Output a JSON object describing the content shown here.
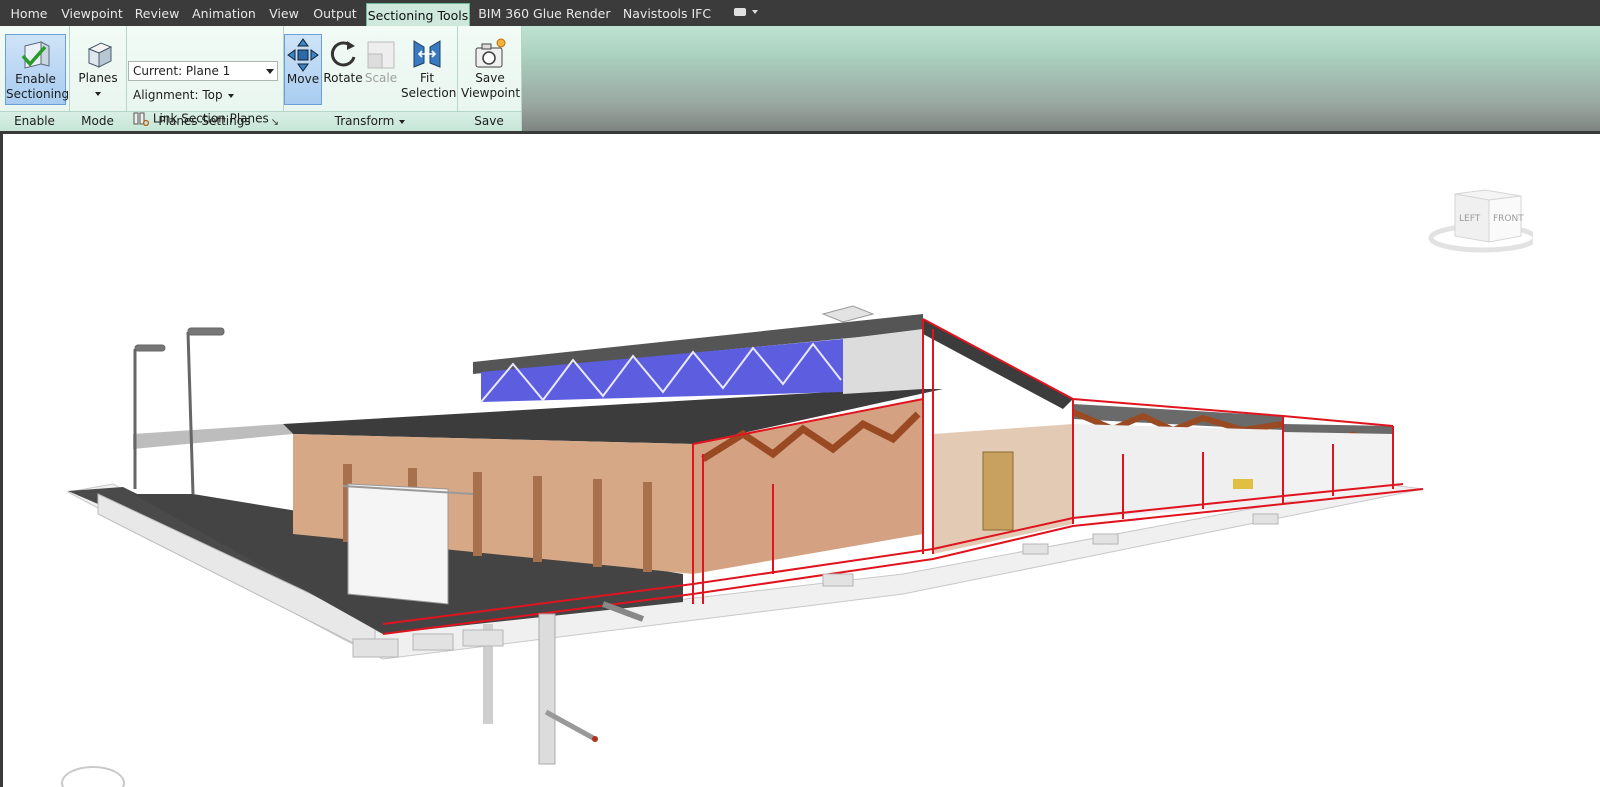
{
  "menubar": {
    "tabs": [
      {
        "label": "Home"
      },
      {
        "label": "Viewpoint"
      },
      {
        "label": "Review"
      },
      {
        "label": "Animation"
      },
      {
        "label": "View"
      },
      {
        "label": "Output"
      },
      {
        "label": "Sectioning Tools",
        "active": true
      },
      {
        "label": "BIM 360 Glue"
      },
      {
        "label": "Render"
      },
      {
        "label": "Navistools IFC"
      }
    ]
  },
  "ribbon": {
    "enable": {
      "button_label_1": "Enable",
      "button_label_2": "Sectioning",
      "panel_title": "Enable"
    },
    "mode": {
      "button_label": "Planes",
      "panel_title": "Mode"
    },
    "planes_settings": {
      "current_plane": "Current: Plane 1",
      "alignment_label": "Alignment: Top",
      "link_label": "Link Section Planes",
      "panel_title": "Planes Settings"
    },
    "transform": {
      "move_label": "Move",
      "rotate_label": "Rotate",
      "scale_label": "Scale",
      "fit_label_1": "Fit",
      "fit_label_2": "Selection",
      "panel_title": "Transform"
    },
    "save": {
      "button_label_1": "Save",
      "button_label_2": "Viewpoint",
      "panel_title": "Save"
    }
  },
  "viewcube": {
    "left_face": "LEFT",
    "front_face": "FRONT"
  },
  "colors": {
    "accent": "#cfe8dc",
    "section_red": "#e0141e",
    "roof": "#3d3d3d",
    "wood": "#cf9f7d",
    "truss": "#9a4a23",
    "glass": "#5a5ad8"
  }
}
